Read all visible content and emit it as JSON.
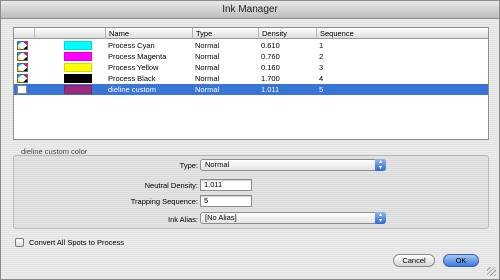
{
  "window": {
    "title": "Ink Manager"
  },
  "table": {
    "columns": [
      "Name",
      "Type",
      "Density",
      "Sequence"
    ],
    "rows": [
      {
        "name": "Process Cyan",
        "type": "Normal",
        "density": "0.610",
        "sequence": "1",
        "color": "#00ffff",
        "icon": "process-ink-icon"
      },
      {
        "name": "Process Magenta",
        "type": "Normal",
        "density": "0.760",
        "sequence": "2",
        "color": "#ff00ff",
        "icon": "process-ink-icon"
      },
      {
        "name": "Process Yellow",
        "type": "Normal",
        "density": "0.160",
        "sequence": "3",
        "color": "#ffff00",
        "icon": "process-ink-icon"
      },
      {
        "name": "Process Black",
        "type": "Normal",
        "density": "1.700",
        "sequence": "4",
        "color": "#000000",
        "icon": "process-ink-icon"
      },
      {
        "name": "dieline custom",
        "type": "Normal",
        "density": "1.011",
        "sequence": "5",
        "color": "#9c2a7f",
        "icon": "spot-ink-icon",
        "selected": true
      }
    ]
  },
  "details": {
    "group_title": "dieline custom color",
    "type_label": "Type:",
    "type_value": "Normal",
    "neutral_density_label": "Neutral Density:",
    "neutral_density_value": "1.011",
    "trapping_sequence_label": "Trapping Sequence:",
    "trapping_sequence_value": "5",
    "ink_alias_label": "Ink Alias:",
    "ink_alias_value": "[No Alias]"
  },
  "convert_all_spots_label": "Convert All Spots to Process",
  "buttons": {
    "cancel": "Cancel",
    "ok": "OK"
  },
  "colors": {
    "selection": "#3875d7",
    "ok_button": "#3a7ae0"
  }
}
